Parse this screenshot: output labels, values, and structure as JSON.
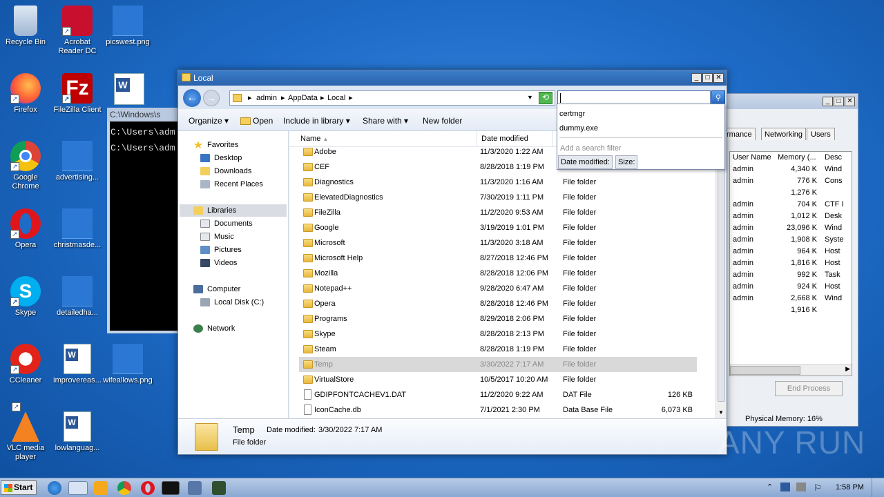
{
  "desktop": {
    "icons": [
      {
        "label": "Recycle Bin",
        "icon": "recycle-bin-icon"
      },
      {
        "label": "Acrobat Reader DC",
        "icon": "acrobat-icon"
      },
      {
        "label": "picswest.png",
        "icon": "image-file-icon"
      },
      {
        "label": "Firefox",
        "icon": "firefox-icon"
      },
      {
        "label": "FileZilla Client",
        "icon": "filezilla-icon"
      },
      {
        "label": "Google Chrome",
        "icon": "chrome-icon"
      },
      {
        "label": "advertising...",
        "icon": "image-file-icon"
      },
      {
        "label": "Opera",
        "icon": "opera-icon"
      },
      {
        "label": "christmasde...",
        "icon": "image-file-icon"
      },
      {
        "label": "Skype",
        "icon": "skype-icon"
      },
      {
        "label": "detailedha...",
        "icon": "image-file-icon"
      },
      {
        "label": "CCleaner",
        "icon": "ccleaner-icon"
      },
      {
        "label": "improvereas...",
        "icon": "word-doc-icon"
      },
      {
        "label": "wifeallows.png",
        "icon": "image-file-icon"
      },
      {
        "label": "VLC media player",
        "icon": "vlc-icon"
      },
      {
        "label": "lowlanguag...",
        "icon": "word-doc-icon"
      }
    ]
  },
  "cmd": {
    "title": "C:\\Windows\\s",
    "lines": [
      "C:\\Users\\adm",
      "C:\\Users\\adm"
    ]
  },
  "taskmgr": {
    "tabs": [
      "rmance",
      "Networking",
      "Users"
    ],
    "columns": [
      "User Name",
      "Memory (...",
      "Desc"
    ],
    "rows": [
      {
        "user": "admin",
        "mem": "4,340 K",
        "desc": "Wind"
      },
      {
        "user": "admin",
        "mem": "776 K",
        "desc": "Cons"
      },
      {
        "user": "",
        "mem": "1,276 K",
        "desc": ""
      },
      {
        "user": "admin",
        "mem": "704 K",
        "desc": "CTF I"
      },
      {
        "user": "admin",
        "mem": "1,012 K",
        "desc": "Desk"
      },
      {
        "user": "admin",
        "mem": "23,096 K",
        "desc": "Wind"
      },
      {
        "user": "admin",
        "mem": "1,908 K",
        "desc": "Syste"
      },
      {
        "user": "admin",
        "mem": "964 K",
        "desc": "Host"
      },
      {
        "user": "admin",
        "mem": "1,816 K",
        "desc": "Host"
      },
      {
        "user": "admin",
        "mem": "992 K",
        "desc": "Task"
      },
      {
        "user": "admin",
        "mem": "924 K",
        "desc": "Host"
      },
      {
        "user": "admin",
        "mem": "2,668 K",
        "desc": "Wind"
      },
      {
        "user": "",
        "mem": "1,916 K",
        "desc": ""
      }
    ],
    "end_process": "End Process",
    "status": "Physical Memory: 16%"
  },
  "explorer": {
    "title": "Local",
    "breadcrumb": [
      "admin",
      "AppData",
      "Local"
    ],
    "toolbar": {
      "organize": "Organize",
      "open": "Open",
      "include": "Include in library",
      "share": "Share with",
      "newfolder": "New folder"
    },
    "search": {
      "value": "",
      "suggestions": [
        "certmgr",
        "dummy.exe"
      ],
      "add_filter": "Add a search filter",
      "filters": [
        "Date modified:",
        "Size:"
      ]
    },
    "nav": {
      "favorites": "Favorites",
      "desktop": "Desktop",
      "downloads": "Downloads",
      "recent": "Recent Places",
      "libraries": "Libraries",
      "documents": "Documents",
      "music": "Music",
      "pictures": "Pictures",
      "videos": "Videos",
      "computer": "Computer",
      "localdisk": "Local Disk (C:)",
      "network": "Network"
    },
    "columns": {
      "name": "Name",
      "date": "Date modified"
    },
    "files": [
      {
        "name": "Adobe",
        "date": "11/3/2020 1:22 AM",
        "type": "",
        "size": ""
      },
      {
        "name": "CEF",
        "date": "8/28/2018 1:19 PM",
        "type": "",
        "size": ""
      },
      {
        "name": "Diagnostics",
        "date": "11/3/2020 1:16 AM",
        "type": "File folder",
        "size": ""
      },
      {
        "name": "ElevatedDiagnostics",
        "date": "7/30/2019 1:11 PM",
        "type": "File folder",
        "size": ""
      },
      {
        "name": "FileZilla",
        "date": "11/2/2020 9:53 AM",
        "type": "File folder",
        "size": ""
      },
      {
        "name": "Google",
        "date": "3/19/2019 1:01 PM",
        "type": "File folder",
        "size": ""
      },
      {
        "name": "Microsoft",
        "date": "11/3/2020 3:18 AM",
        "type": "File folder",
        "size": ""
      },
      {
        "name": "Microsoft Help",
        "date": "8/27/2018 12:46 PM",
        "type": "File folder",
        "size": ""
      },
      {
        "name": "Mozilla",
        "date": "8/28/2018 12:06 PM",
        "type": "File folder",
        "size": ""
      },
      {
        "name": "Notepad++",
        "date": "9/28/2020 6:47 AM",
        "type": "File folder",
        "size": ""
      },
      {
        "name": "Opera",
        "date": "8/28/2018 12:46 PM",
        "type": "File folder",
        "size": ""
      },
      {
        "name": "Programs",
        "date": "8/29/2018 2:06 PM",
        "type": "File folder",
        "size": ""
      },
      {
        "name": "Skype",
        "date": "8/28/2018 2:13 PM",
        "type": "File folder",
        "size": ""
      },
      {
        "name": "Steam",
        "date": "8/28/2018 1:19 PM",
        "type": "File folder",
        "size": ""
      },
      {
        "name": "Temp",
        "date": "3/30/2022 7:17 AM",
        "type": "File folder",
        "size": ""
      },
      {
        "name": "VirtualStore",
        "date": "10/5/2017 10:20 AM",
        "type": "File folder",
        "size": ""
      },
      {
        "name": "GDIPFONTCACHEV1.DAT",
        "date": "11/2/2020 9:22 AM",
        "type": "DAT File",
        "size": "126 KB"
      },
      {
        "name": "IconCache.db",
        "date": "7/1/2021 2:30 PM",
        "type": "Data Base File",
        "size": "6,073 KB"
      }
    ],
    "selected_index": 14,
    "details": {
      "name": "Temp",
      "date_label": "Date modified:",
      "date_value": "3/30/2022 7:17 AM",
      "type": "File folder"
    }
  },
  "taskbar": {
    "start": "Start",
    "clock": "1:58 PM"
  },
  "watermark": "ANY RUN"
}
